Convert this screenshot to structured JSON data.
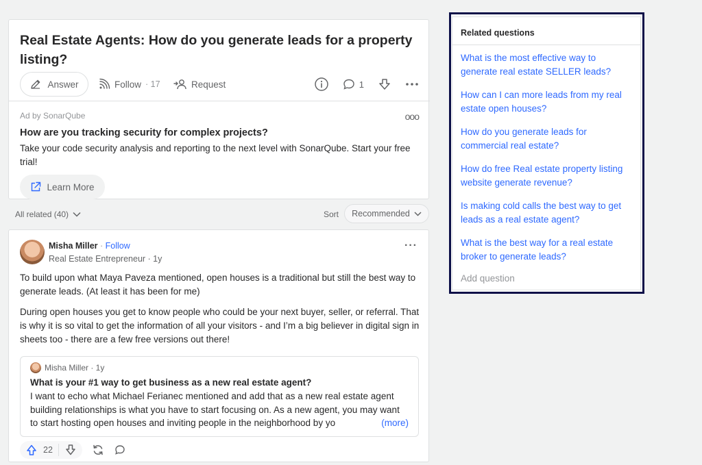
{
  "question": {
    "title": "Real Estate Agents: How do you generate leads for a property listing?",
    "answer_label": "Answer",
    "follow_label": "Follow",
    "follow_count": "· 17",
    "request_label": "Request",
    "comment_count": "1"
  },
  "ad": {
    "by": "Ad by SonarQube",
    "title": "How are you tracking security for complex projects?",
    "text": "Take your code security analysis and reporting to the next level with SonarQube. Start your free trial!",
    "more": "ooo",
    "button_label": "Learn More"
  },
  "related_bar": {
    "all_related": "All related (40)",
    "sort_label": "Sort",
    "sort_value": "Recommended"
  },
  "answer": {
    "author_name": "Misha Miller",
    "dot": " · ",
    "follow_label": "Follow",
    "author_sub": "Real Estate Entrepreneur · 1y",
    "more": "···",
    "paragraphs": [
      "To build upon what Maya Paveza mentioned, open houses is a traditional but still the best way to generate leads. (At least it has been for me)",
      "During open houses you get to know people who could be your next buyer, seller, or referral. That is why it is so vital to get the information of all your visitors - and I’m a big believer in digital sign in sheets too - there are a few free versions out there!"
    ],
    "quote": {
      "author": "Misha Miller · 1y",
      "title": "What is your #1 way to get business as a new real estate agent?",
      "text": "I want to echo what Michael Ferianec mentioned and add that as a new real estate agent building relationships is what you have to start focusing on. As a new agent, you may want to start hosting open houses and inviting people in the neighborhood by yo",
      "more_label": "(more)"
    },
    "upvotes": "22"
  },
  "sidebar": {
    "title": "Related questions",
    "items": [
      "What is the most effective way to generate real estate SELLER leads?",
      "How can I can more leads from my real estate open houses?",
      "How do you generate leads for commercial real estate?",
      "How do free Real estate property listing website generate revenue?",
      "Is making cold calls the best way to get leads as a real estate agent?",
      "What is the best way for a real estate broker to generate leads?"
    ],
    "add_question": "Add question"
  },
  "colors": {
    "link": "#2e69ff",
    "sidebar_border": "#0d1048",
    "text": "#282829",
    "muted": "#636466"
  }
}
